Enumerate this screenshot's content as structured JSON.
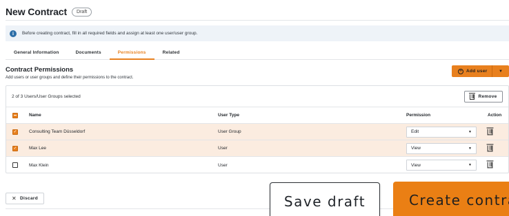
{
  "page": {
    "title": "New Contract",
    "status_badge": "Draft"
  },
  "info_banner": {
    "icon": "info-icon",
    "text": "Before creating contract, fill in all required fields and assign at least one user/user group."
  },
  "tabs": [
    {
      "label": "General Information",
      "active": false
    },
    {
      "label": "Documents",
      "active": false
    },
    {
      "label": "Permissions",
      "active": true
    },
    {
      "label": "Related",
      "active": false
    }
  ],
  "section": {
    "title": "Contract Permissions",
    "description": "Add users or user groups and define their permissions to the contract."
  },
  "add_user": {
    "icon": "plus-circle-icon",
    "label": "Add user",
    "caret": "chevron-down-icon"
  },
  "table": {
    "selection_text": "2 of 3 Users/User Groups selected",
    "remove_label": "Remove",
    "columns": {
      "name": "Name",
      "user_type": "User Type",
      "permission": "Permission",
      "action": "Action"
    },
    "rows": [
      {
        "name": "Consulting Team Düsseldorf",
        "user_type": "User Group",
        "permission": "Edit",
        "selected": true
      },
      {
        "name": "Max Lee",
        "user_type": "User",
        "permission": "View",
        "selected": true
      },
      {
        "name": "Max Klein",
        "user_type": "User",
        "permission": "View",
        "selected": false
      }
    ]
  },
  "footer": {
    "discard_label": "Discard",
    "save_draft_label": "Save draft",
    "create_label": "Create contra"
  },
  "colors": {
    "accent": "#e8801e",
    "selected_row": "#fbece0",
    "info_bg": "#eef3f8"
  }
}
